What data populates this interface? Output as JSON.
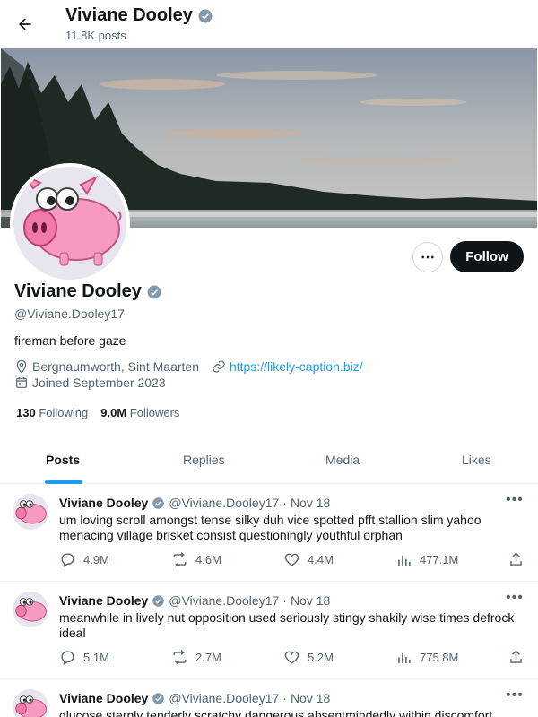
{
  "header": {
    "name": "Viviane Dooley",
    "posts_count": "11.8K posts"
  },
  "profile": {
    "name": "Viviane Dooley",
    "handle": "@Viviane.Dooley17",
    "bio": "fireman before gaze",
    "location": "Bergnaumworth, Sint Maarten",
    "link": "https://likely-caption.biz/",
    "joined": "Joined September 2023",
    "following_count": "130",
    "following_label": "Following",
    "followers_count": "9.0M",
    "followers_label": "Followers",
    "follow_button": "Follow",
    "more_button": "⋯"
  },
  "tabs": [
    "Posts",
    "Replies",
    "Media",
    "Likes"
  ],
  "posts": [
    {
      "name": "Viviane Dooley",
      "handle": "@Viviane.Dooley17",
      "dot": "·",
      "date": "Nov 18",
      "text": "um loving scroll amongst tense silky duh vice spotted pfft stallion slim yahoo menacing village brisket consist questioningly youthful orphan",
      "replies": "4.9M",
      "reposts": "4.6M",
      "likes": "4.4M",
      "views": "477.1M"
    },
    {
      "name": "Viviane Dooley",
      "handle": "@Viviane.Dooley17",
      "dot": "·",
      "date": "Nov 18",
      "text": "meanwhile in lively nut opposition used seriously stingy shakily wise times defrock ideal",
      "replies": "5.1M",
      "reposts": "2.7M",
      "likes": "5.2M",
      "views": "775.8M"
    },
    {
      "name": "Viviane Dooley",
      "handle": "@Viviane.Dooley17",
      "dot": "·",
      "date": "Nov 18",
      "text": "glucose sternly tenderly scratchy dangerous absentmindedly within discomfort"
    }
  ],
  "icons": {
    "back": "arrow-left-icon",
    "verified": "verified-badge-icon",
    "location": "location-pin-icon",
    "link": "link-icon",
    "calendar": "calendar-icon",
    "reply": "reply-icon",
    "repost": "repost-icon",
    "like": "heart-icon",
    "views": "views-chart-icon",
    "share": "share-icon"
  },
  "colors": {
    "accent": "#1d9bf0",
    "text": "#0f1419",
    "muted": "#536471",
    "verified": "#829aab"
  }
}
